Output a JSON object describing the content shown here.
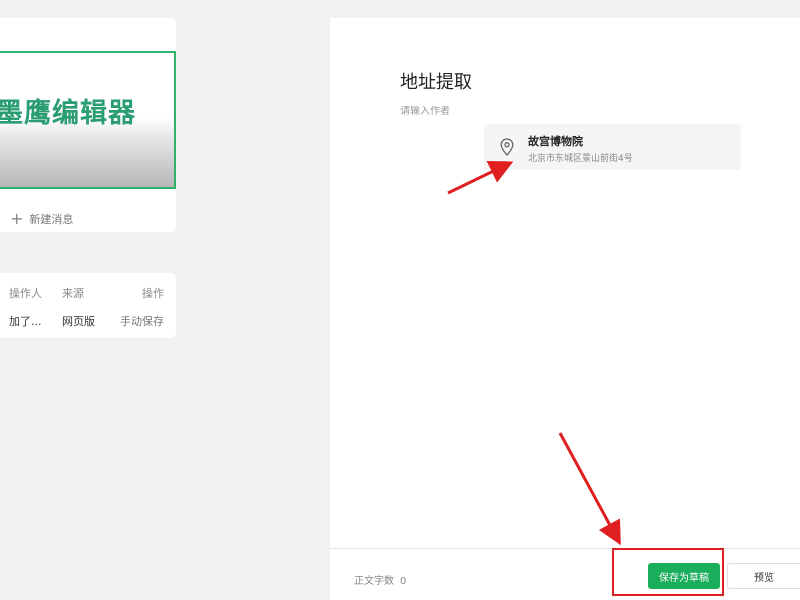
{
  "sidebar": {
    "cover_text": "墨鹰编辑器",
    "new_message_label": "新建消息",
    "history": {
      "headers": [
        "操作人",
        "来源",
        "操作"
      ],
      "rows": [
        [
          "加了...",
          "网页版",
          "手动保存"
        ]
      ]
    }
  },
  "editor": {
    "title": "地址提取",
    "author_placeholder": "请输入作者",
    "location": {
      "icon": "location-pin-icon",
      "name": "故宫博物院",
      "address": "北京市东城区景山前街4号"
    }
  },
  "footer": {
    "word_count_label": "正文字数",
    "word_count_value": "0",
    "save_draft_label": "保存为草稿",
    "preview_label": "预览"
  },
  "colors": {
    "accent_green": "#1aad5b",
    "annotation_red": "#e02020",
    "cover_border": "#2fb36b"
  }
}
